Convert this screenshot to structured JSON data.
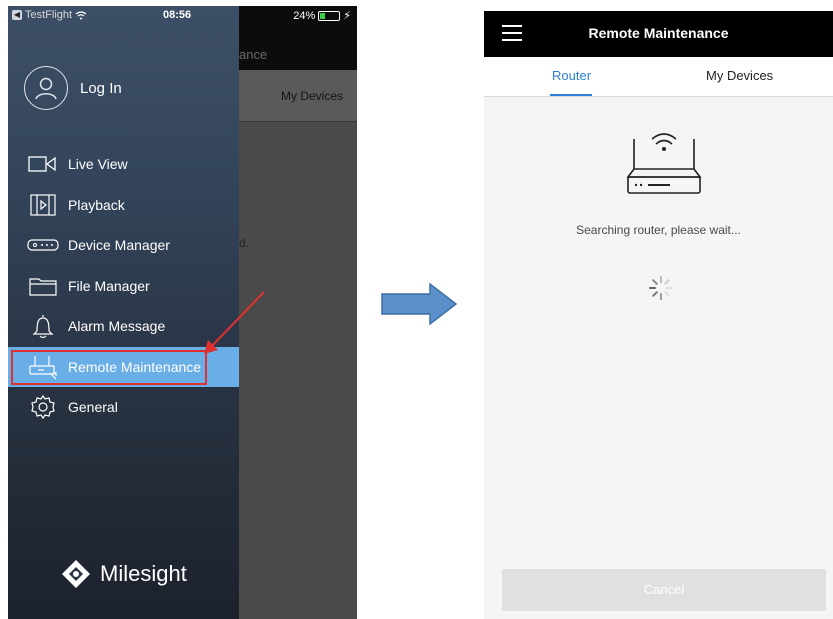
{
  "left_phone": {
    "statusbar": {
      "carrier": "TestFlight",
      "time": "08:56",
      "battery": "24%",
      "battery_level": 0.24
    },
    "background_header_fragment": "ance",
    "background_tab": "My Devices",
    "background_text_fragment": "d.",
    "login_label": "Log In",
    "menu": [
      {
        "label": "Live View",
        "icon": "camera-icon"
      },
      {
        "label": "Playback",
        "icon": "playback-icon"
      },
      {
        "label": "Device Manager",
        "icon": "device-manager-icon"
      },
      {
        "label": "File Manager",
        "icon": "folder-icon"
      },
      {
        "label": "Alarm Message",
        "icon": "bell-icon"
      },
      {
        "label": "Remote Maintenance",
        "icon": "router-icon",
        "active": true
      },
      {
        "label": "General",
        "icon": "gear-icon"
      }
    ],
    "brand": "Milesight",
    "highlight_color": "#6aaee8",
    "annotation_color": "#e03030"
  },
  "right_phone": {
    "title": "Remote Maintenance",
    "tabs": [
      "Router",
      "My Devices"
    ],
    "active_tab": "Router",
    "status_text": "Searching router, please wait...",
    "cancel_label": "Cancel",
    "accent_color": "#2b7fd8"
  },
  "transition_arrow_color": "#5b8fc9"
}
